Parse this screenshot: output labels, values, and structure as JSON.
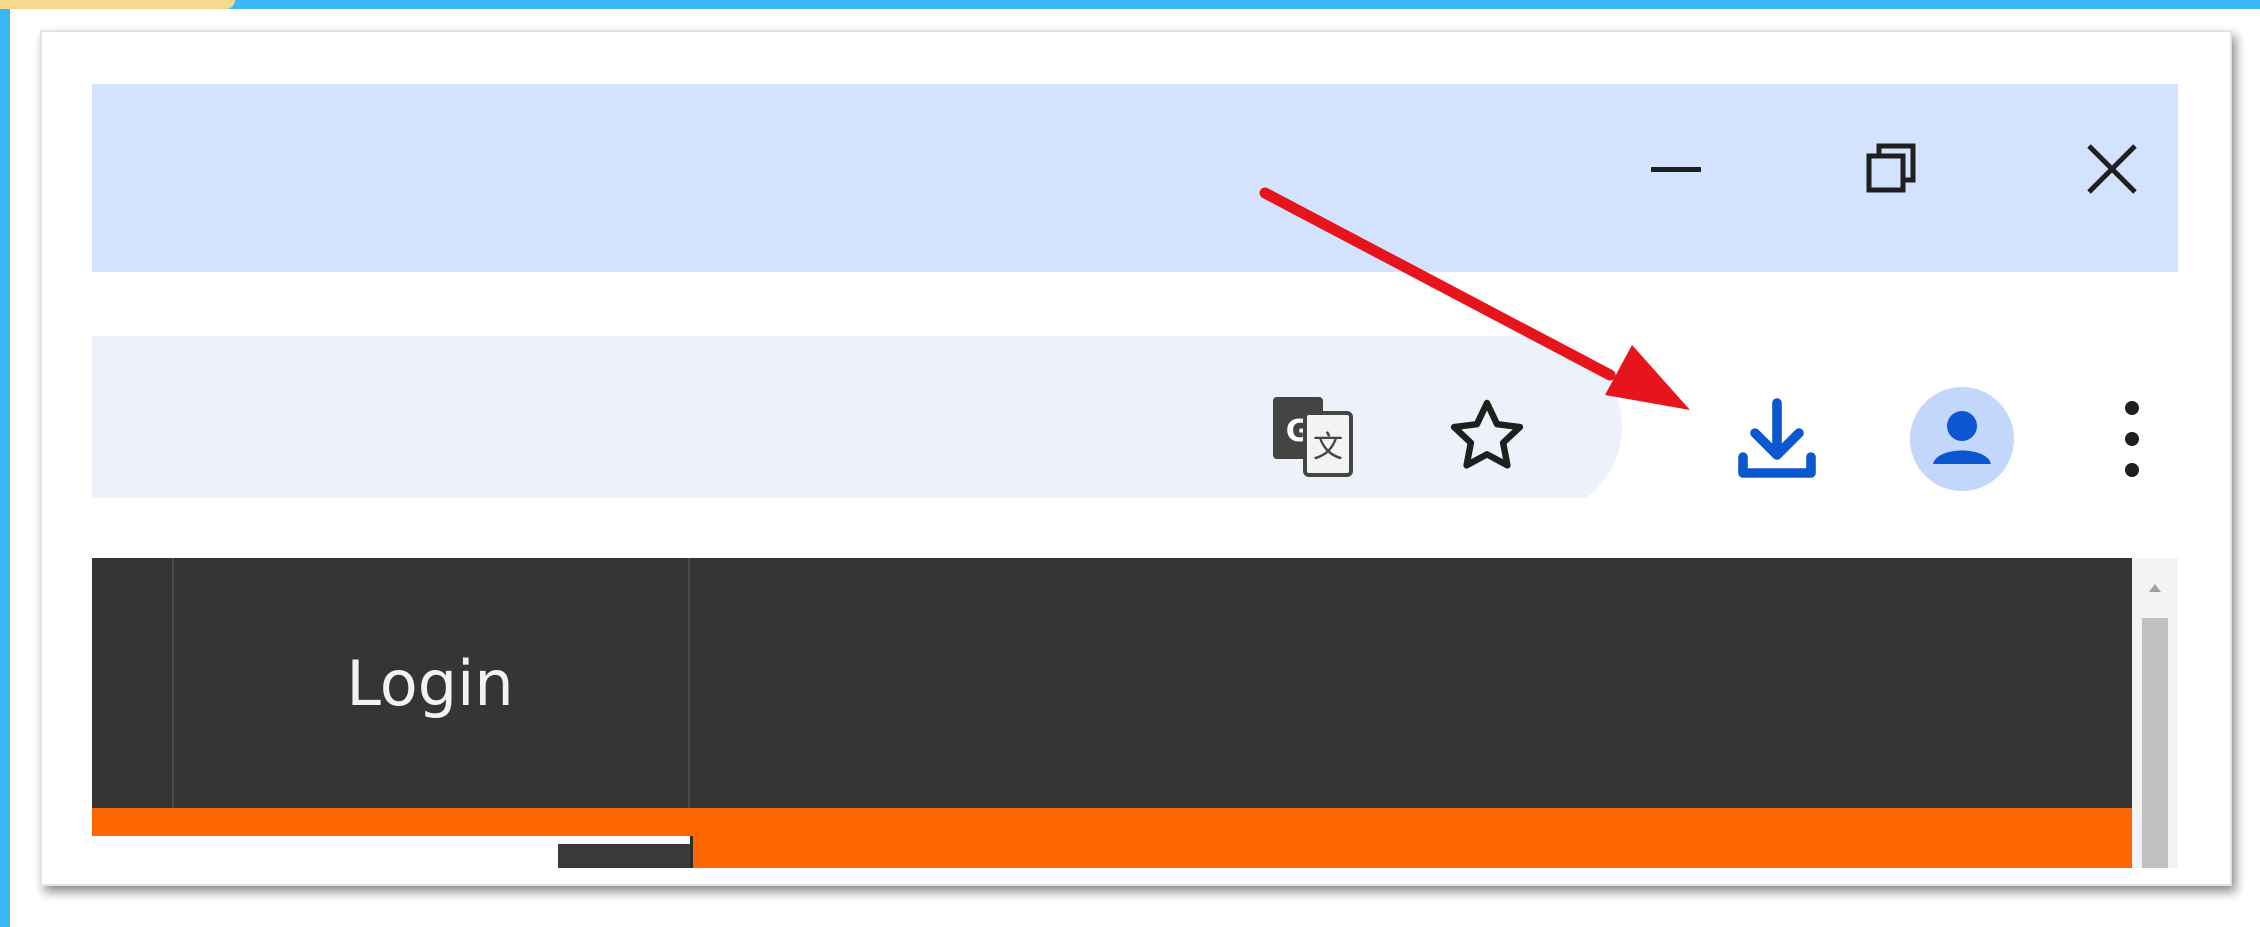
{
  "window_controls": {
    "minimize": "minimize-icon",
    "restore": "restore-icon",
    "close": "close-icon"
  },
  "omnibox": {
    "translate_icon": "google-translate-icon",
    "bookmark_icon": "star-icon"
  },
  "toolbar": {
    "download_icon": "download-icon",
    "profile_icon": "profile-avatar-icon",
    "menu_icon": "more-vertical-icon"
  },
  "page": {
    "nav_login": "Login"
  },
  "annotation": {
    "arrow_color": "#e8141b",
    "points_to": "download-button"
  },
  "colors": {
    "frame": "#3cb6f5",
    "titlebar": "#d3e3fd",
    "omnibox": "#edf2fa",
    "download_icon": "#0b57d0",
    "profile_bg": "#c2d7fb",
    "navbar": "#353535",
    "accent_bar": "#ff6600"
  }
}
